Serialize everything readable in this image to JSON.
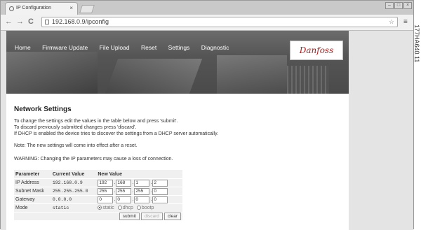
{
  "browser": {
    "tab_title": "IP Configuration",
    "tab_close": "×",
    "url": "192.168.0.9/ipconfig",
    "back_glyph": "←",
    "forward_glyph": "→",
    "reload_glyph": "C",
    "star_glyph": "☆",
    "menu_glyph": "≡",
    "win_min": "–",
    "win_max": "□",
    "win_close": "×"
  },
  "nav": {
    "items": [
      "Home",
      "Firmware Update",
      "File Upload",
      "Reset",
      "Settings",
      "Diagnostic"
    ]
  },
  "logo": {
    "text": "Danfoss"
  },
  "content": {
    "heading": "Network Settings",
    "intro": [
      "To change the settings edit the values in the table below and press 'submit'.",
      "To discard previously submitted changes press 'discard'.",
      "If DHCP is enabled the device tries to discover the settings from a DHCP server automatically."
    ],
    "note": "Note: The new settings will come into effect after a reset.",
    "warning": "WARNING: Changing the IP parameters may cause a loss of connection."
  },
  "table": {
    "headers": [
      "Parameter",
      "Current Value",
      "New Value"
    ],
    "rows": [
      {
        "param": "IP Address",
        "current": "192.168.0.9",
        "new": [
          "192",
          "168",
          "1",
          "2"
        ]
      },
      {
        "param": "Subnet Mask",
        "current": "255.255.255.0",
        "new": [
          "255",
          "255",
          "255",
          "0"
        ]
      },
      {
        "param": "Gateway",
        "current": "0.0.0.0",
        "new": [
          "0",
          "0",
          "0",
          "0"
        ]
      }
    ],
    "mode": {
      "label": "Mode",
      "current": "static",
      "options": [
        "static",
        "dhcp",
        "bootp"
      ],
      "selected": "static"
    },
    "buttons": {
      "submit": "submit",
      "discard": "discard",
      "clear": "clear"
    }
  },
  "side_code": "177HA640.11"
}
